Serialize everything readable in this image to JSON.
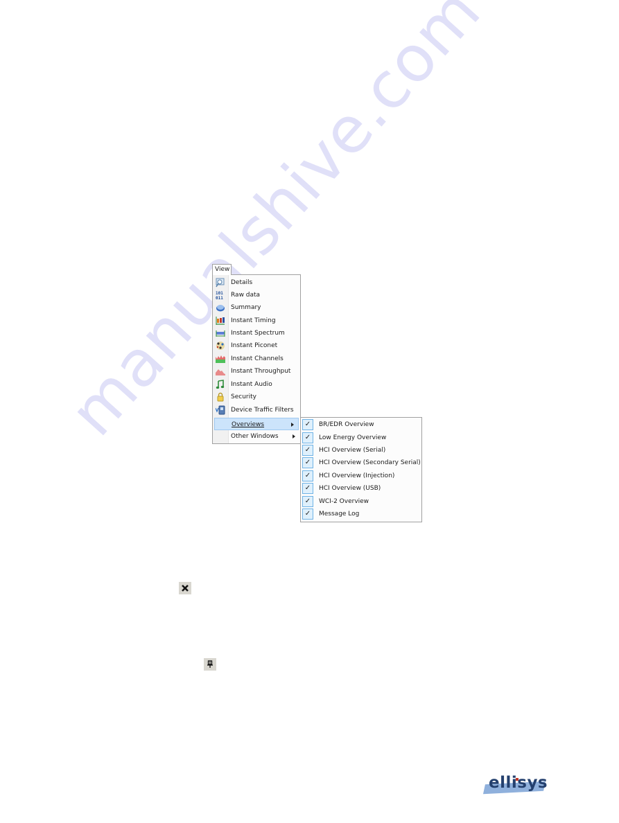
{
  "watermark": {
    "text": "manualshive.com"
  },
  "menu": {
    "title": "View",
    "items": [
      {
        "label": "Details",
        "icon": "details-magnifier-icon"
      },
      {
        "label": "Raw data",
        "icon": "raw-data-binary-icon"
      },
      {
        "label": "Summary",
        "icon": "summary-disc-icon"
      },
      {
        "label": "Instant Timing",
        "icon": "instant-timing-icon"
      },
      {
        "label": "Instant Spectrum",
        "icon": "instant-spectrum-icon"
      },
      {
        "label": "Instant Piconet",
        "icon": "instant-piconet-icon"
      },
      {
        "label": "Instant Channels",
        "icon": "instant-channels-icon"
      },
      {
        "label": "Instant Throughput",
        "icon": "instant-throughput-icon"
      },
      {
        "label": "Instant Audio",
        "icon": "music-note-icon"
      },
      {
        "label": "Security",
        "icon": "padlock-icon"
      },
      {
        "label": "Device Traffic Filters",
        "icon": "device-filter-icon"
      }
    ],
    "submenus": [
      {
        "label": "Overviews",
        "highlighted": true
      },
      {
        "label": "Other Windows",
        "highlighted": false
      }
    ]
  },
  "overviews_submenu": {
    "items": [
      {
        "label": "BR/EDR Overview",
        "checked": true
      },
      {
        "label": "Low Energy Overview",
        "checked": true
      },
      {
        "label": "HCI Overview (Serial)",
        "checked": true
      },
      {
        "label": "HCI Overview (Secondary Serial)",
        "checked": true
      },
      {
        "label": "HCI Overview (Injection)",
        "checked": true
      },
      {
        "label": "HCI Overview (USB)",
        "checked": true
      },
      {
        "label": "WCI-2 Overview",
        "checked": true
      },
      {
        "label": "Message Log",
        "checked": true
      }
    ],
    "check_glyph": "✓"
  },
  "toolbar_icons": {
    "close": "close-x-icon",
    "pin": "pushpin-icon"
  },
  "logo": {
    "text": "ellisys"
  }
}
